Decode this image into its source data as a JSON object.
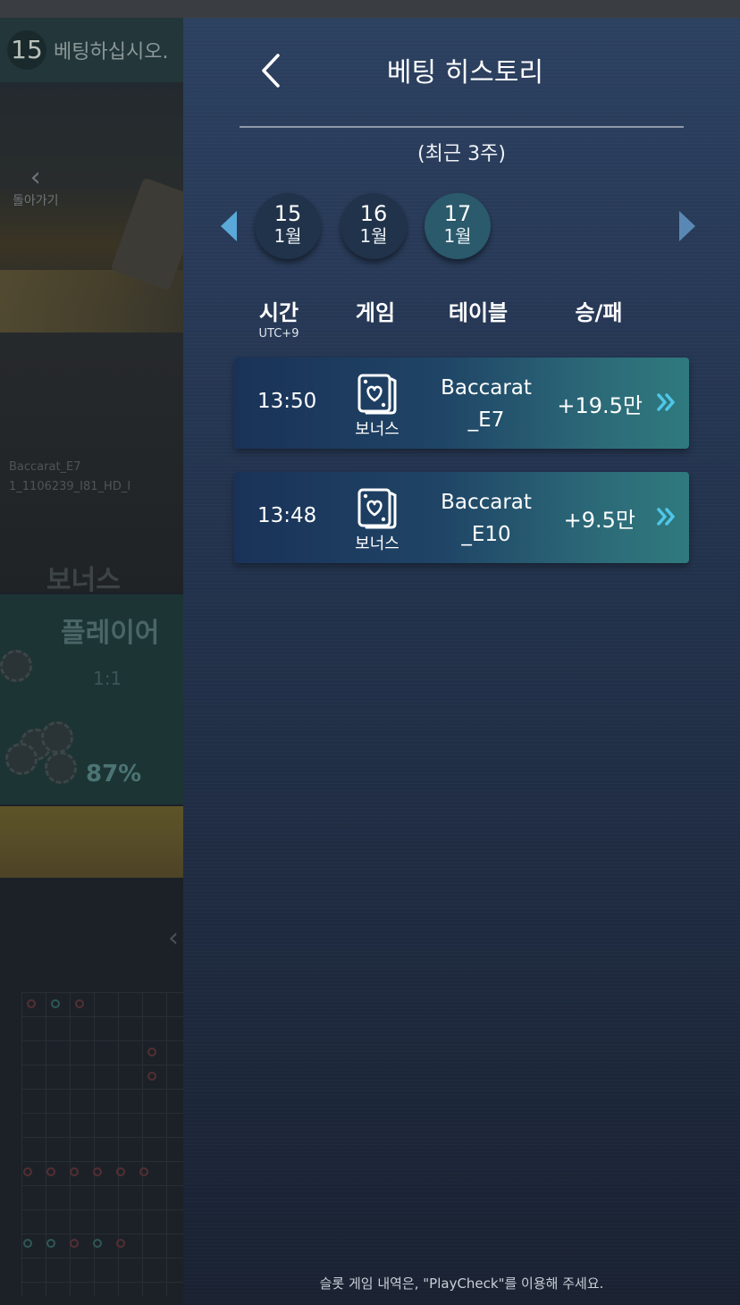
{
  "background": {
    "timer": "15",
    "timer_text": "베팅하십시오.",
    "back_label": "돌아가기",
    "table_label_1": "Baccarat_E7",
    "table_label_2": "1_1106239_I81_HD_I",
    "bonus_label": "보너스",
    "player_label": "플레이어",
    "player_odds": "1:1",
    "player_pct": "87%"
  },
  "panel": {
    "title": "베팅 히스토리",
    "subtitle": "(최근 3주)",
    "footer_note": "슬롯 게임 내역은, \"PlayCheck\"를 이용해 주세요."
  },
  "dates": [
    {
      "day": "15",
      "month": "1월",
      "active": false
    },
    {
      "day": "16",
      "month": "1월",
      "active": false
    },
    {
      "day": "17",
      "month": "1월",
      "active": true
    }
  ],
  "columns": {
    "time": "시간",
    "time_sub": "UTC+9",
    "game": "게임",
    "table": "테이블",
    "result": "승/패"
  },
  "rows": [
    {
      "time": "13:50",
      "game": "보너스",
      "game_icon": "card-heart-icon",
      "table_line1": "Baccarat",
      "table_line2": "_E7",
      "result": "+19.5만"
    },
    {
      "time": "13:48",
      "game": "보너스",
      "game_icon": "card-heart-icon",
      "table_line1": "Baccarat",
      "table_line2": "_E10",
      "result": "+9.5만"
    }
  ],
  "colors": {
    "accent": "#5aa9d8",
    "chevron": "#4fc6e8",
    "active_date": "#2a5a6c"
  }
}
